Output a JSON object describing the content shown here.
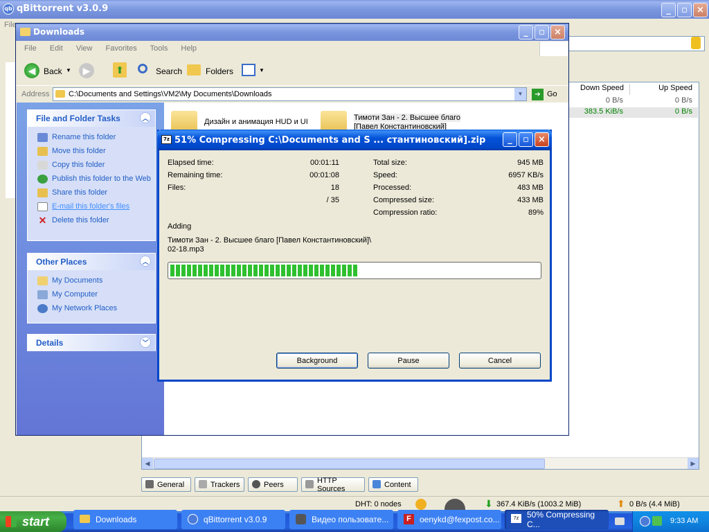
{
  "qbittorrent": {
    "title": "qBittorrent v3.0.9",
    "menu_file": "File",
    "columns": {
      "down_speed": "Down Speed",
      "up_speed": "Up Speed"
    },
    "rows": [
      {
        "down": "0 B/s",
        "up": "0 B/s"
      },
      {
        "down": "383.5 KiB/s",
        "up": "0 B/s"
      }
    ],
    "tabs": [
      "General",
      "Trackers",
      "Peers",
      "HTTP Sources",
      "Content"
    ],
    "status": {
      "dht": "DHT: 0 nodes",
      "down": "367.4 KiB/s (1003.2 MiB)",
      "up": "0 B/s (4.4 MiB)"
    }
  },
  "explorer": {
    "title": "Downloads",
    "menu": [
      "File",
      "Edit",
      "View",
      "Favorites",
      "Tools",
      "Help"
    ],
    "toolbar": {
      "back": "Back",
      "search": "Search",
      "folders": "Folders"
    },
    "address_label": "Address",
    "address_value": "C:\\Documents and Settings\\VM2\\My Documents\\Downloads",
    "go": "Go",
    "file_tasks": {
      "header": "File and Folder Tasks",
      "items": [
        "Rename this folder",
        "Move this folder",
        "Copy this folder",
        "Publish this folder to the Web",
        "Share this folder",
        "E-mail this folder's files",
        "Delete this folder"
      ]
    },
    "other_places": {
      "header": "Other Places",
      "items": [
        "My Documents",
        "My Computer",
        "My Network Places"
      ]
    },
    "details": {
      "header": "Details"
    },
    "folders": [
      {
        "name": "Дизайн и анимация HUD и UI"
      },
      {
        "name_line1": "Тимоти Зан - 2. Высшее благо",
        "name_line2": "[Павел Константиновский]"
      }
    ]
  },
  "dialog": {
    "title": "51% Compressing C:\\Documents and S ... стантиновский].zip",
    "left": [
      {
        "label": "Elapsed time:",
        "value": "00:01:11"
      },
      {
        "label": "Remaining time:",
        "value": "00:01:08"
      },
      {
        "label": "Files:",
        "value": "18"
      },
      {
        "label": "",
        "value": "/ 35"
      }
    ],
    "right": [
      {
        "label": "Total size:",
        "value": "945 MB"
      },
      {
        "label": "Speed:",
        "value": "6957 KB/s"
      },
      {
        "label": "Processed:",
        "value": "483 MB"
      },
      {
        "label": "Compressed size:",
        "value": "433 MB"
      },
      {
        "label": "Compression ratio:",
        "value": "89%"
      }
    ],
    "action": "Adding",
    "file_line1": "Тимоти Зан - 2. Высшее благо [Павел Константиновский]\\",
    "file_line2": "02-18.mp3",
    "progress": 0.51,
    "buttons": {
      "background": "Background",
      "pause": "Pause",
      "cancel": "Cancel"
    }
  },
  "taskbar": {
    "start": "start",
    "buttons": [
      "Downloads",
      "qBittorrent v3.0.9",
      "Видео пользовате...",
      "oenykd@fexpost.co...",
      "50% Compressing C..."
    ],
    "clock": "9:33 AM"
  }
}
